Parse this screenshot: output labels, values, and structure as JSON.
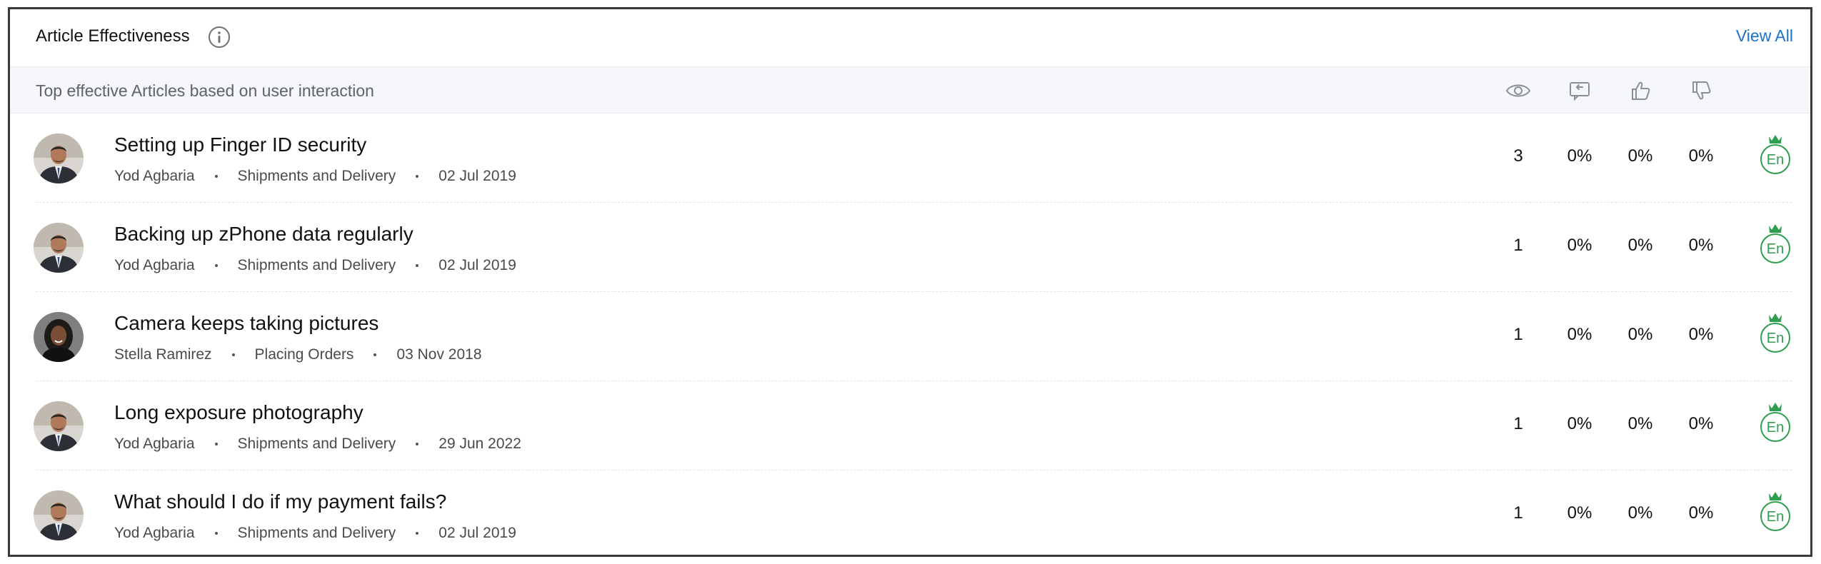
{
  "widget": {
    "title": "Article Effectiveness",
    "view_all_label": "View All",
    "subtitle": "Top effective Articles based on user interaction",
    "columns": [
      {
        "icon": "eye-icon",
        "meaning": "views"
      },
      {
        "icon": "reply-icon",
        "meaning": "responses"
      },
      {
        "icon": "thumbs-up-icon",
        "meaning": "likes"
      },
      {
        "icon": "thumbs-down-icon",
        "meaning": "dislikes"
      }
    ]
  },
  "articles": [
    {
      "title": "Setting up Finger ID security",
      "author": "Yod Agbaria",
      "category": "Shipments and Delivery",
      "date": "02 Jul 2019",
      "avatar": "male",
      "views": "3",
      "responses": "0%",
      "likes": "0%",
      "dislikes": "0%",
      "lang": "En"
    },
    {
      "title": "Backing up zPhone data regularly",
      "author": "Yod Agbaria",
      "category": "Shipments and Delivery",
      "date": "02 Jul 2019",
      "avatar": "male",
      "views": "1",
      "responses": "0%",
      "likes": "0%",
      "dislikes": "0%",
      "lang": "En"
    },
    {
      "title": "Camera keeps taking pictures",
      "author": "Stella Ramirez",
      "category": "Placing Orders",
      "date": "03 Nov 2018",
      "avatar": "female",
      "views": "1",
      "responses": "0%",
      "likes": "0%",
      "dislikes": "0%",
      "lang": "En"
    },
    {
      "title": "Long exposure photography",
      "author": "Yod Agbaria",
      "category": "Shipments and Delivery",
      "date": "29 Jun 2022",
      "avatar": "male",
      "views": "1",
      "responses": "0%",
      "likes": "0%",
      "dislikes": "0%",
      "lang": "En"
    },
    {
      "title": "What should I do if my payment fails?",
      "author": "Yod Agbaria",
      "category": "Shipments and Delivery",
      "date": "02 Jul 2019",
      "avatar": "male",
      "views": "1",
      "responses": "0%",
      "likes": "0%",
      "dislikes": "0%",
      "lang": "En"
    }
  ],
  "colors": {
    "link": "#1a73c8",
    "badge_green": "#2e9e4f",
    "subheader_bg": "#f5f7fa",
    "icon_gray": "#8a8f98"
  }
}
